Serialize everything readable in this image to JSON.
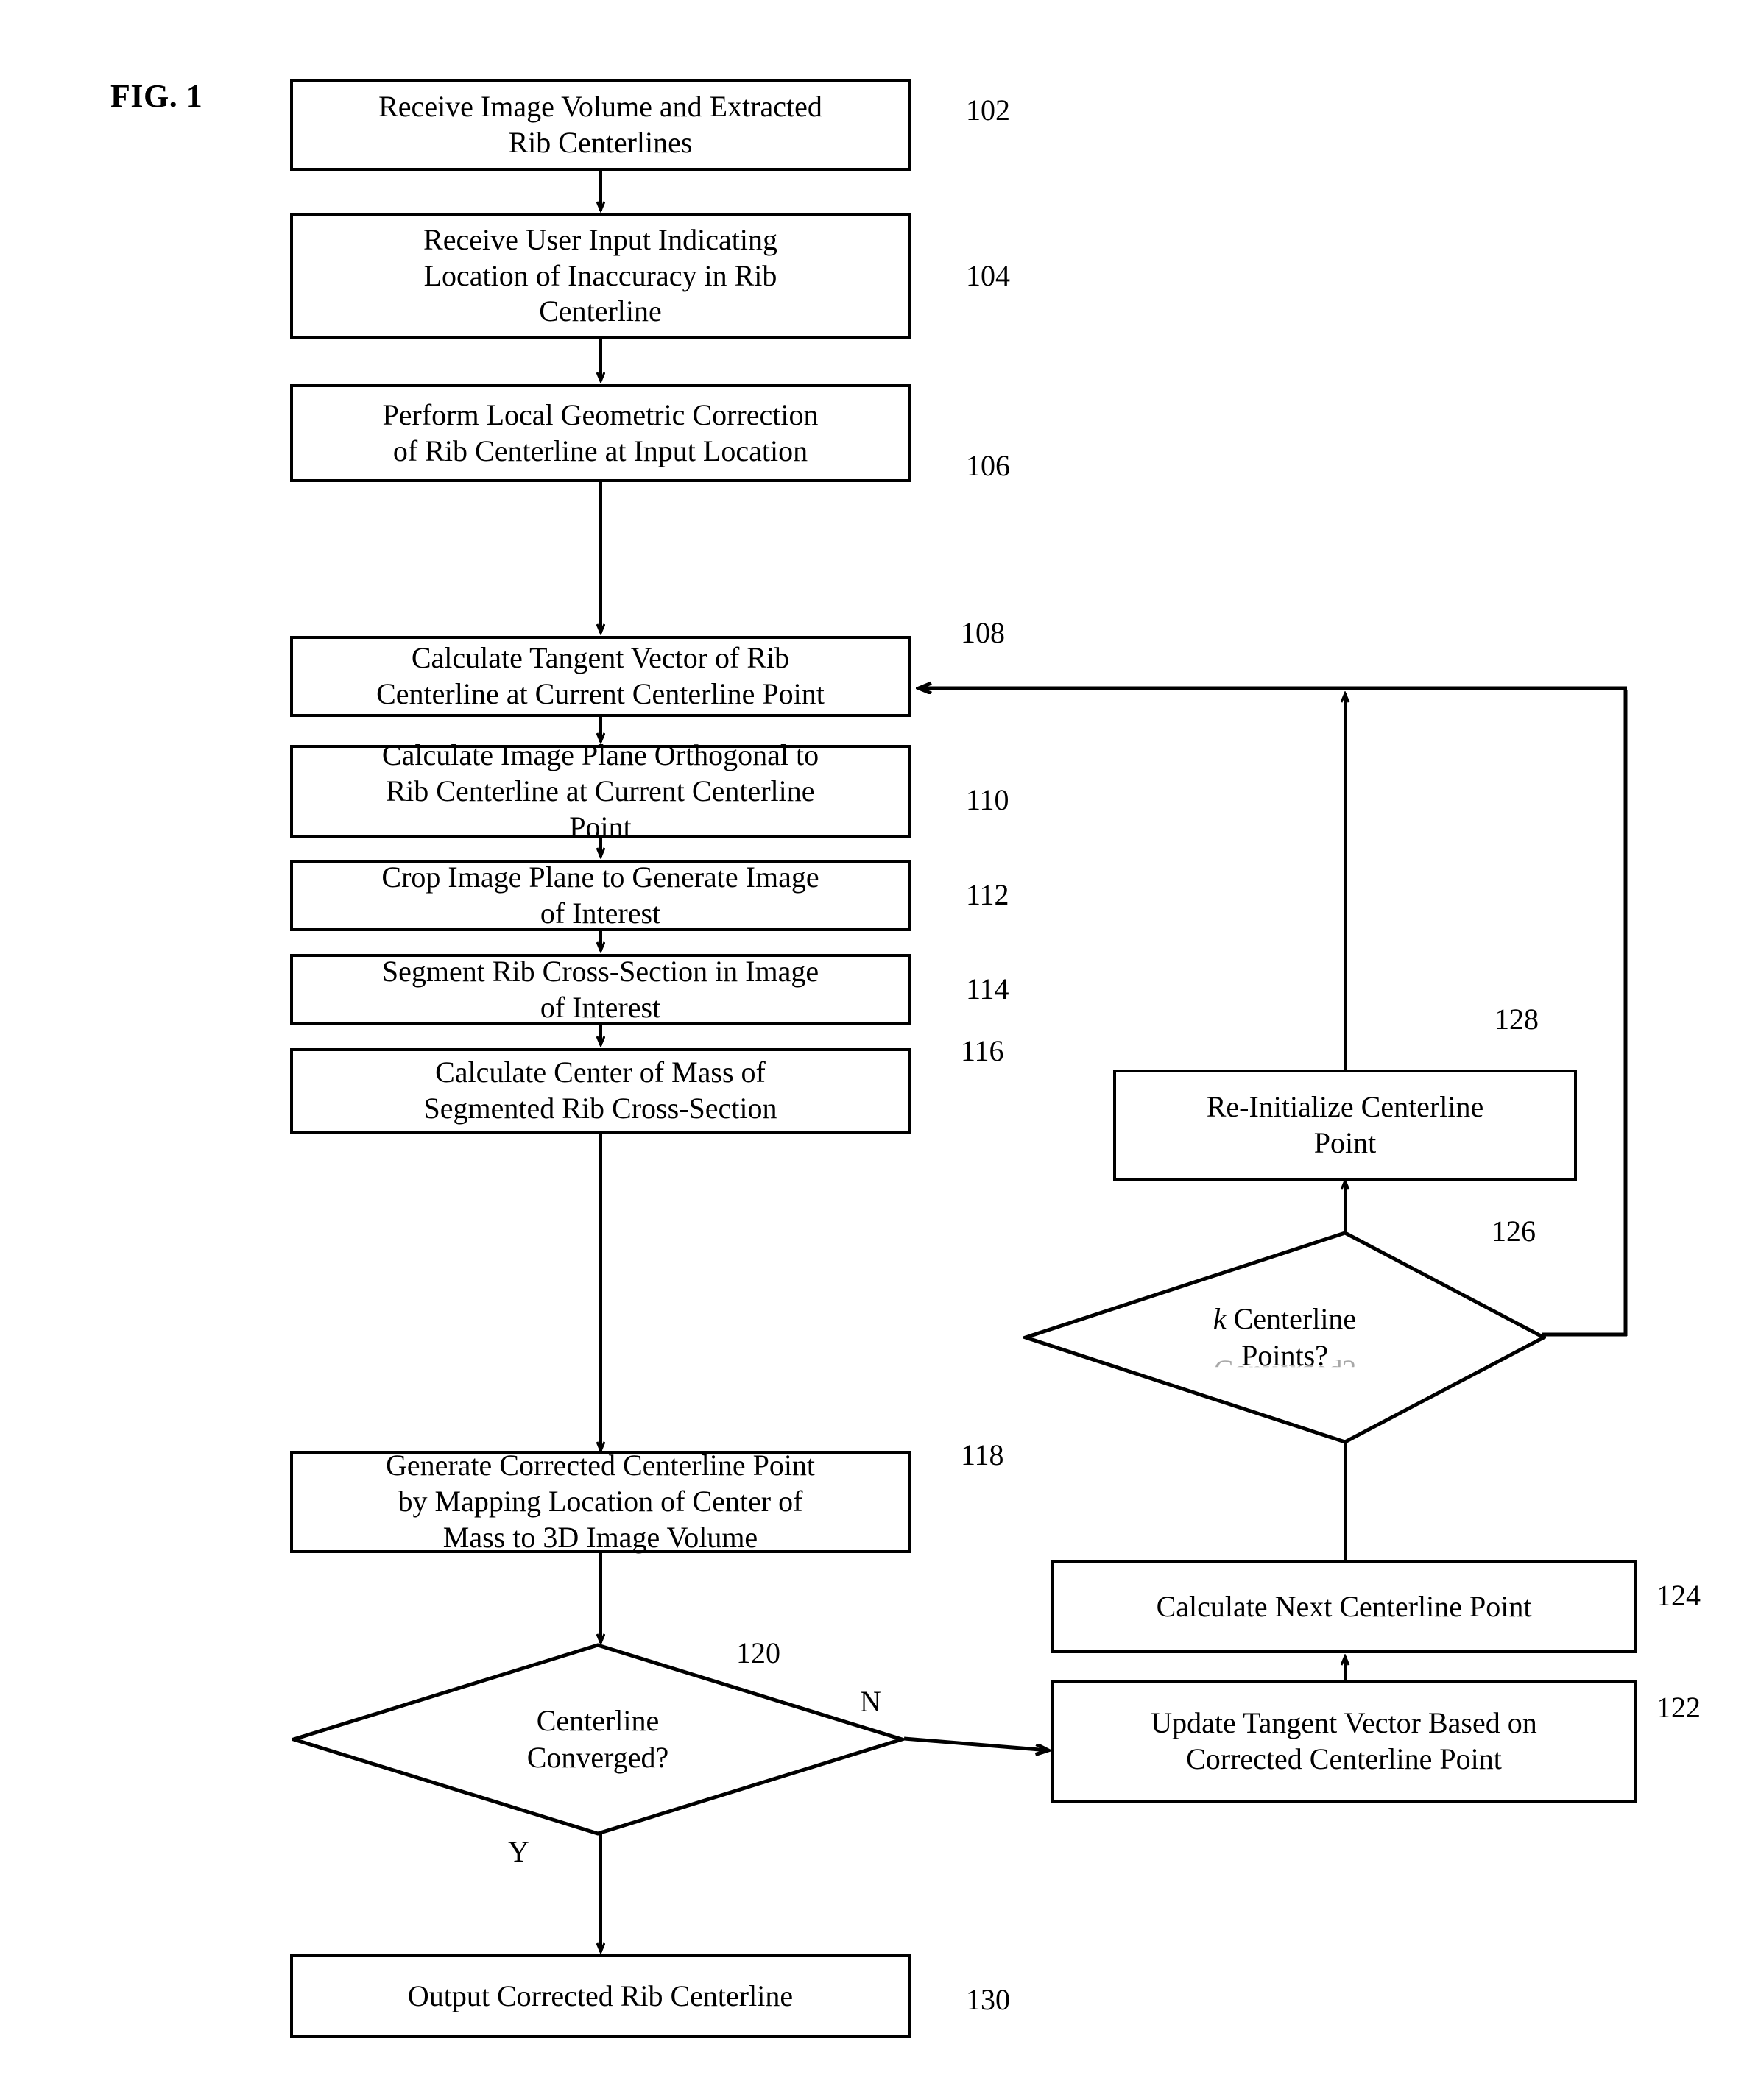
{
  "figure": {
    "label": "FIG. 1"
  },
  "nodes": {
    "n102": {
      "ref": "102",
      "text": "Receive Image Volume and Extracted\nRib Centerlines"
    },
    "n104": {
      "ref": "104",
      "text": "Receive User Input Indicating\nLocation of Inaccuracy in Rib\nCenterline"
    },
    "n106": {
      "ref": "106",
      "text": "Perform Local Geometric Correction\nof Rib Centerline at Input Location"
    },
    "n108": {
      "ref": "108",
      "text": "Calculate Tangent Vector of Rib\nCenterline at Current Centerline Point"
    },
    "n110": {
      "ref": "110",
      "text": "Calculate Image Plane Orthogonal to\nRib Centerline at Current Centerline\nPoint"
    },
    "n112": {
      "ref": "112",
      "text": "Crop Image Plane to Generate Image\nof Interest"
    },
    "n114": {
      "ref": "114",
      "text": "Segment Rib Cross-Section in Image\nof Interest"
    },
    "n116": {
      "ref": "116",
      "text": "Calculate Center of Mass of\nSegmented Rib Cross-Section"
    },
    "n118": {
      "ref": "118",
      "text": "Generate Corrected Centerline Point\nby Mapping Location of Center of\nMass to 3D Image Volume"
    },
    "n120": {
      "ref": "120",
      "text": "Centerline\nConverged?",
      "yes_label": "Y",
      "no_label": "N"
    },
    "n122": {
      "ref": "122",
      "text": "Update Tangent Vector Based on\nCorrected Centerline Point"
    },
    "n124": {
      "ref": "124",
      "text": "Calculate Next Centerline Point"
    },
    "n126": {
      "ref": "126",
      "text_italic": "k",
      "text_rest": " Centerline\nPoints?",
      "ghost_text": "Converged?"
    },
    "n128": {
      "ref": "128",
      "text": "Re-Initialize Centerline\nPoint"
    },
    "n130": {
      "ref": "130",
      "text": "Output Corrected Rib Centerline"
    }
  },
  "colors": {
    "stroke": "#000000",
    "background": "#ffffff"
  }
}
